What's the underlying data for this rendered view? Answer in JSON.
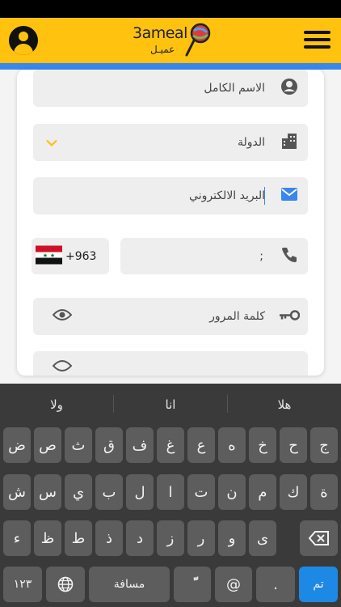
{
  "header": {
    "logo_text": "3ameal",
    "logo_sub": "عميـل",
    "brand_color": "#FFC20E",
    "accent_color": "#3A86EC"
  },
  "form": {
    "full_name": {
      "placeholder": "الاسم الكامل",
      "icon": "person-icon"
    },
    "country": {
      "placeholder": "الدولة",
      "icon": "building-icon",
      "dropdown_icon": "chevron-down-icon"
    },
    "email": {
      "placeholder": "البريد الالكتروني",
      "icon": "mail-icon"
    },
    "country_code": {
      "value": "+963",
      "flag": "syria-flag-icon"
    },
    "phone": {
      "value": ";",
      "icon": "phone-icon"
    },
    "password": {
      "placeholder": "كلمة المرور",
      "icon": "key-icon",
      "toggle_icon": "eye-icon"
    }
  },
  "keyboard": {
    "suggestions": [
      "ولا",
      "انا",
      "هلا"
    ],
    "row1": [
      "ض",
      "ص",
      "ث",
      "ق",
      "ف",
      "غ",
      "ع",
      "ه",
      "خ",
      "ح",
      "ج"
    ],
    "row2": [
      "ش",
      "س",
      "ي",
      "ب",
      "ل",
      "ا",
      "ت",
      "ن",
      "م",
      "ك",
      "ة"
    ],
    "row3": [
      "ء",
      "ظ",
      "ط",
      "ذ",
      "د",
      "ز",
      "ر",
      "و",
      "ى"
    ],
    "numbers_key": "١٢٣",
    "space_key": "مسافة",
    "tanween_key": "ًّ",
    "at_key": "@",
    "period_key": ".",
    "done_key": "تم"
  }
}
